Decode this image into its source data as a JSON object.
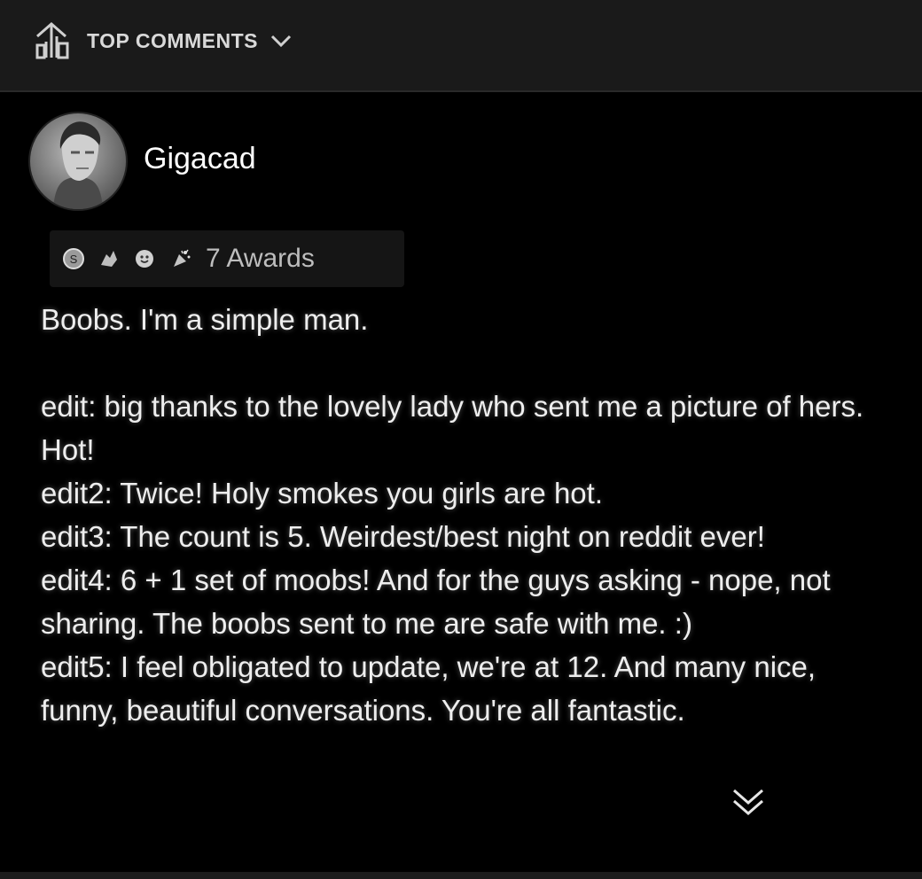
{
  "header": {
    "sort_label": "TOP COMMENTS",
    "sort_icon": "sort-arrows-icon",
    "dropdown_icon": "chevron-down-icon"
  },
  "comment": {
    "username": "Gigacad",
    "avatar": "avatar-icon",
    "awards": {
      "icons": [
        "silver-award-icon",
        "hands-award-icon",
        "wholesome-award-icon",
        "party-award-icon"
      ],
      "label": "7 Awards"
    },
    "paragraphs": [
      "Boobs. I'm a simple man.",
      "edit: big thanks to the lovely lady who sent me a picture of hers. Hot!",
      "edit2: Twice! Holy smokes you girls are hot.",
      "edit3: The count is 5. Weirdest/best night on reddit ever!",
      "edit4: 6 + 1 set of moobs! And for the guys asking - nope, not sharing. The boobs sent to me are safe with me. :)",
      "edit5: I feel obligated to update, we're at 12. And many nice, funny, beautiful conversations. You're all fantastic."
    ],
    "collapse_icon": "double-chevron-down-icon"
  },
  "colors": {
    "background": "#000000",
    "header_bg": "#1a1a1a",
    "text": "#eeeeee"
  }
}
